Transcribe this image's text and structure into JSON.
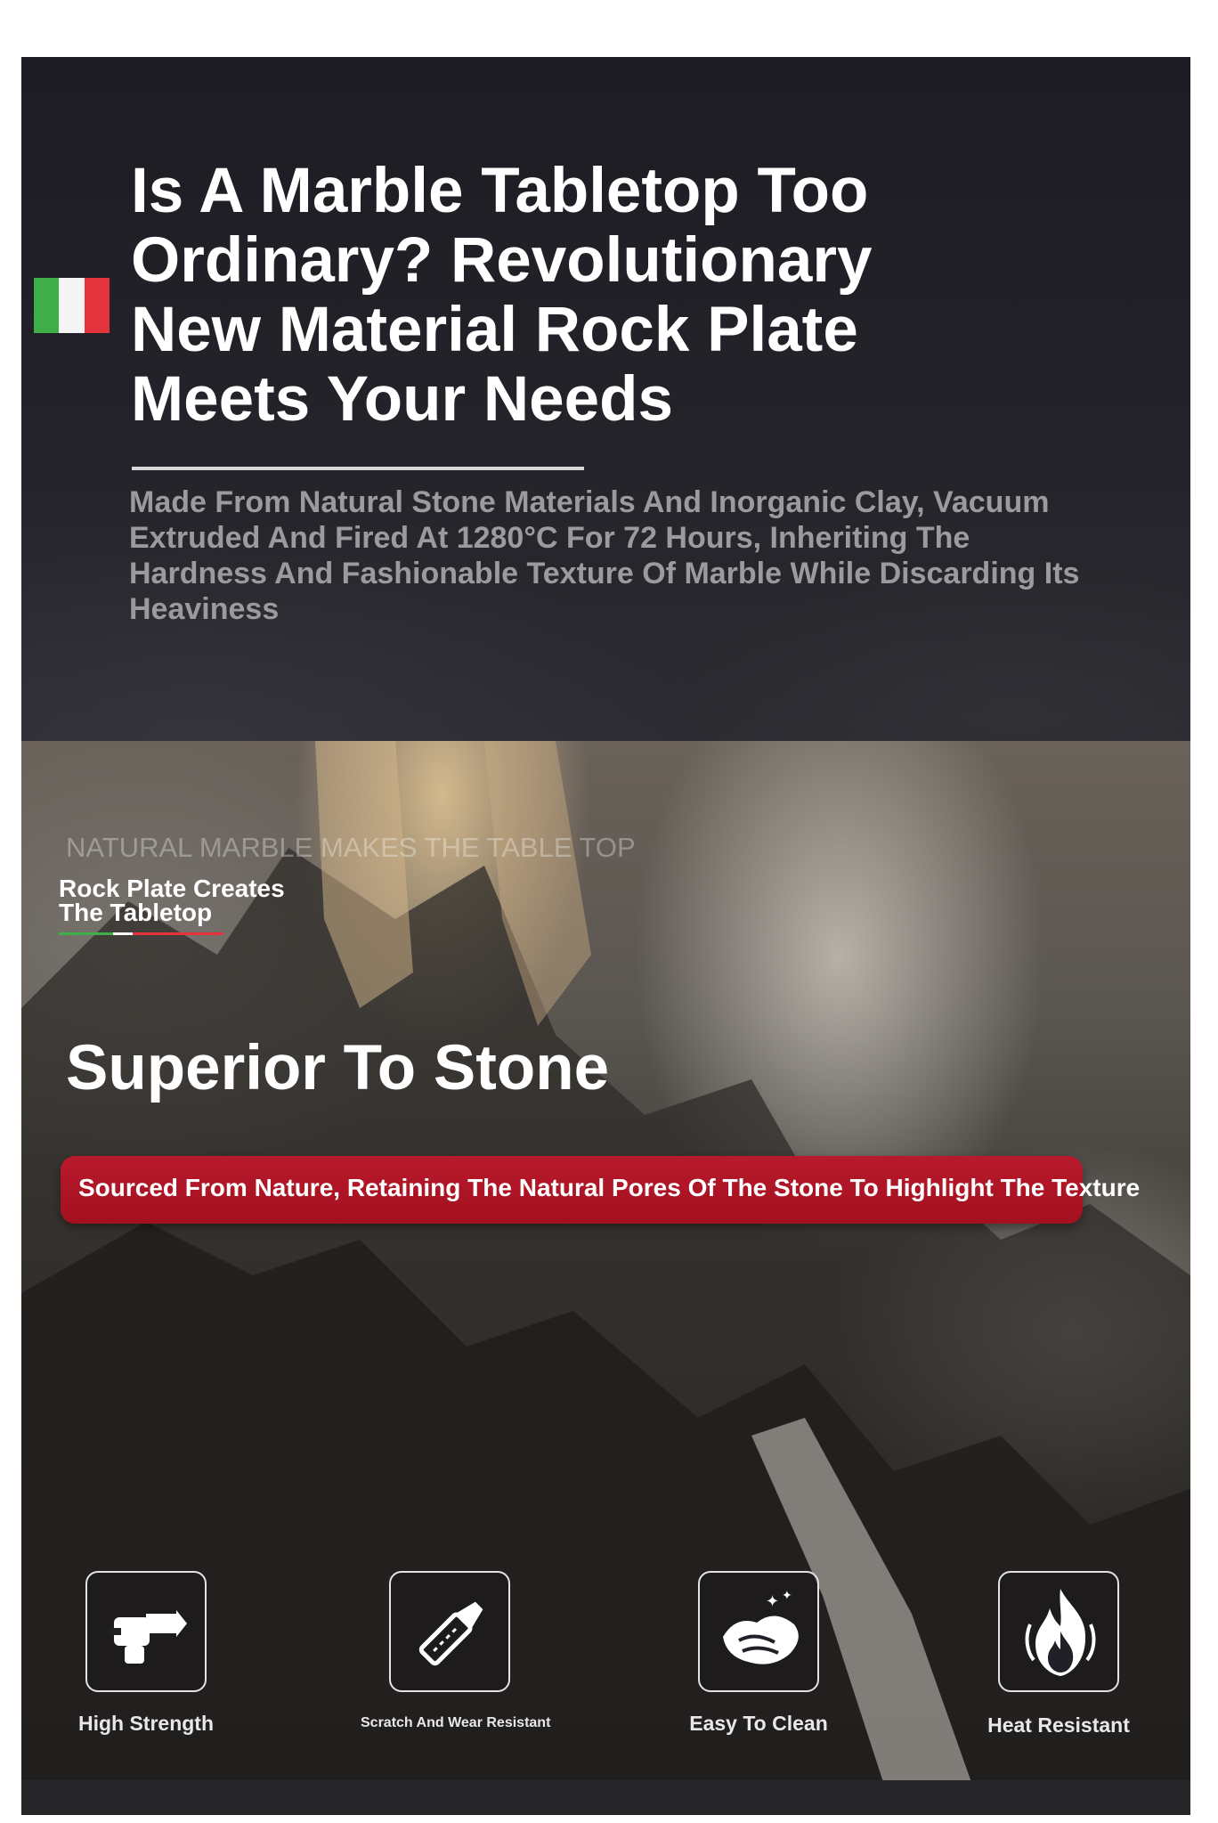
{
  "hero": {
    "title": "Is A Marble Tabletop Too Ordinary? Revolutionary New Material Rock Plate Meets Your Needs",
    "description": "Made From Natural Stone Materials And Inorganic Clay, Vacuum Extruded And Fired At 1280°C For 72 Hours, Inheriting The Hardness And Fashionable Texture Of Marble While Discarding Its Heaviness"
  },
  "flag": {
    "icon": "italian-flag-icon",
    "colors": [
      "#3fae49",
      "#f4f4f4",
      "#e3343b"
    ]
  },
  "overlay": {
    "ghost_text": "NATURAL MARBLE MAKES THE TABLE TOP",
    "brand_line_1": "Rock Plate Creates",
    "brand_line_2": "The Tabletop"
  },
  "section": {
    "title": "Superior To Stone",
    "banner": "Sourced From Nature, Retaining The Natural Pores Of The Stone To Highlight The Texture",
    "banner_color": "#b01526"
  },
  "features": [
    {
      "label": "High Strength",
      "icon": "hammer-fist-icon"
    },
    {
      "label": "Scratch And Wear Resistant",
      "icon": "utility-knife-icon"
    },
    {
      "label": "Easy To Clean",
      "icon": "cleaning-cloth-icon"
    },
    {
      "label": "Heat Resistant",
      "icon": "flame-icon"
    }
  ]
}
